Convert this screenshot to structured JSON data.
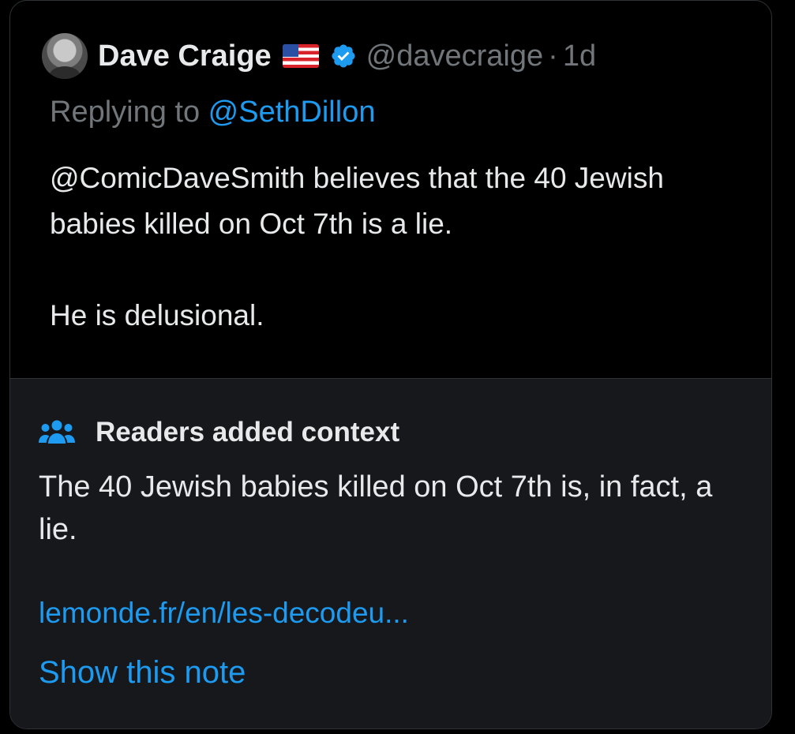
{
  "tweet": {
    "author_name": "Dave Craige",
    "flag_icon": "us-flag-icon",
    "verified_icon": "verified-badge-icon",
    "handle": "@davecraige",
    "separator": "·",
    "time": "1d",
    "replying_prefix": "Replying to ",
    "replying_mention": "@SethDillon",
    "text_lines": [
      "@ComicDaveSmith believes that the 40 Jewish babies killed on Oct 7th is a lie.",
      "He is delusional."
    ]
  },
  "community_note": {
    "icon": "readers-group-icon",
    "title": "Readers added context",
    "text": "The 40 Jewish babies killed on Oct 7th is, in fact, a lie.",
    "link_text": "lemonde.fr/en/les-decodeu...",
    "show_note_label": "Show this note"
  },
  "colors": {
    "background": "#000000",
    "note_background": "#16181c",
    "primary_text": "#e7e9ea",
    "secondary_text": "#71767b",
    "accent_blue": "#1d9bf0",
    "border": "#2f3336"
  }
}
